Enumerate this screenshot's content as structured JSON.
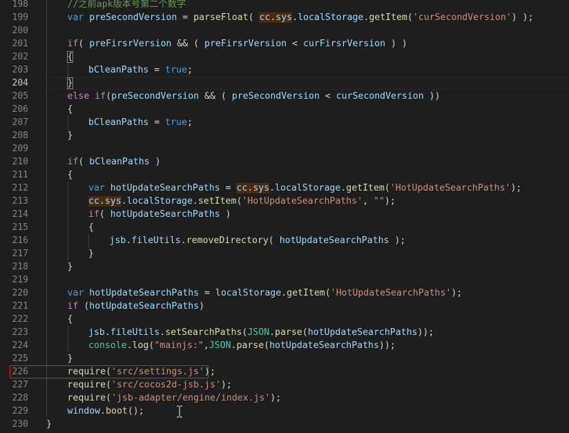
{
  "colors": {
    "background": "#1e1e1e",
    "keyword": "#569cd6",
    "control": "#c586c0",
    "function": "#dcdcaa",
    "string": "#ce9178",
    "comment": "#6a9955",
    "variable": "#9cdcfe",
    "type": "#4ec9b0",
    "highlight_box": "#e01e1e"
  },
  "lines": [
    {
      "n": "198",
      "indent": 1,
      "tokens": [
        [
          "cm",
          "//之前apk版本号第二个数字"
        ]
      ]
    },
    {
      "n": "199",
      "indent": 1,
      "tokens": [
        [
          "kw",
          "var"
        ],
        [
          "pl",
          " "
        ],
        [
          "var",
          "preSecondVersion"
        ],
        [
          "pl",
          " = "
        ],
        [
          "fn",
          "parseFloat"
        ],
        [
          "pl",
          "( "
        ],
        [
          "var hl",
          "cc"
        ],
        [
          "pl hl",
          "."
        ],
        [
          "var hl",
          "sys"
        ],
        [
          "pl",
          "."
        ],
        [
          "var",
          "localStorage"
        ],
        [
          "pl",
          "."
        ],
        [
          "fn",
          "getItem"
        ],
        [
          "pl",
          "("
        ],
        [
          "str",
          "'curSecondVersion'"
        ],
        [
          "pl",
          ") );"
        ]
      ]
    },
    {
      "n": "200",
      "indent": 1,
      "tokens": []
    },
    {
      "n": "201",
      "indent": 1,
      "tokens": [
        [
          "kwc",
          "if"
        ],
        [
          "pl",
          "( "
        ],
        [
          "var",
          "preFirsrVersion"
        ],
        [
          "pl",
          " && ( "
        ],
        [
          "var",
          "preFirsrVersion"
        ],
        [
          "pl",
          " < "
        ],
        [
          "var",
          "curFirsrVersion"
        ],
        [
          "pl",
          " ) )"
        ]
      ]
    },
    {
      "n": "202",
      "indent": 1,
      "tokens": [
        [
          "pl br",
          "{"
        ]
      ]
    },
    {
      "n": "203",
      "indent": 2,
      "tokens": [
        [
          "var",
          "bCleanPaths"
        ],
        [
          "pl",
          " = "
        ],
        [
          "kw",
          "true"
        ],
        [
          "pl",
          ";"
        ]
      ]
    },
    {
      "n": "204",
      "indent": 1,
      "active": true,
      "tokens": [
        [
          "pl br",
          "}"
        ]
      ]
    },
    {
      "n": "205",
      "indent": 1,
      "tokens": [
        [
          "kwc",
          "else"
        ],
        [
          "pl",
          " "
        ],
        [
          "kwc",
          "if"
        ],
        [
          "pl",
          "("
        ],
        [
          "var",
          "preSecondVersion"
        ],
        [
          "pl",
          " && ( "
        ],
        [
          "var",
          "preSecondVersion"
        ],
        [
          "pl",
          " < "
        ],
        [
          "var",
          "curSecondVersion"
        ],
        [
          "pl",
          " ))"
        ]
      ]
    },
    {
      "n": "206",
      "indent": 1,
      "tokens": [
        [
          "pl",
          "{"
        ]
      ]
    },
    {
      "n": "207",
      "indent": 2,
      "tokens": [
        [
          "var",
          "bCleanPaths"
        ],
        [
          "pl",
          " = "
        ],
        [
          "kw",
          "true"
        ],
        [
          "pl",
          ";"
        ]
      ]
    },
    {
      "n": "208",
      "indent": 1,
      "tokens": [
        [
          "pl",
          "}"
        ]
      ]
    },
    {
      "n": "209",
      "indent": 1,
      "tokens": []
    },
    {
      "n": "210",
      "indent": 1,
      "tokens": [
        [
          "kwc",
          "if"
        ],
        [
          "pl",
          "( "
        ],
        [
          "var",
          "bCleanPaths"
        ],
        [
          "pl",
          " )"
        ]
      ]
    },
    {
      "n": "211",
      "indent": 1,
      "tokens": [
        [
          "pl",
          "{"
        ]
      ]
    },
    {
      "n": "212",
      "indent": 2,
      "tokens": [
        [
          "kw",
          "var"
        ],
        [
          "pl",
          " "
        ],
        [
          "var",
          "hotUpdateSearchPaths"
        ],
        [
          "pl",
          " = "
        ],
        [
          "var hl",
          "cc"
        ],
        [
          "pl hl",
          "."
        ],
        [
          "var hl",
          "sys"
        ],
        [
          "pl",
          "."
        ],
        [
          "var",
          "localStorage"
        ],
        [
          "pl",
          "."
        ],
        [
          "fn",
          "getItem"
        ],
        [
          "pl",
          "("
        ],
        [
          "str",
          "'HotUpdateSearchPaths'"
        ],
        [
          "pl",
          ");"
        ]
      ]
    },
    {
      "n": "213",
      "indent": 2,
      "tokens": [
        [
          "var hl",
          "cc"
        ],
        [
          "pl hl",
          "."
        ],
        [
          "var hl",
          "sys"
        ],
        [
          "pl",
          "."
        ],
        [
          "var",
          "localStorage"
        ],
        [
          "pl",
          "."
        ],
        [
          "fn",
          "setItem"
        ],
        [
          "pl",
          "("
        ],
        [
          "str",
          "'HotUpdateSearchPaths'"
        ],
        [
          "pl",
          ", "
        ],
        [
          "str",
          "\"\""
        ],
        [
          "pl",
          ");"
        ]
      ]
    },
    {
      "n": "214",
      "indent": 2,
      "tokens": [
        [
          "kwc",
          "if"
        ],
        [
          "pl",
          "( "
        ],
        [
          "var",
          "hotUpdateSearchPaths"
        ],
        [
          "pl",
          " )"
        ]
      ]
    },
    {
      "n": "215",
      "indent": 2,
      "tokens": [
        [
          "pl",
          "{"
        ]
      ]
    },
    {
      "n": "216",
      "indent": 3,
      "tokens": [
        [
          "var",
          "jsb"
        ],
        [
          "pl",
          "."
        ],
        [
          "var",
          "fileUtils"
        ],
        [
          "pl",
          "."
        ],
        [
          "fn",
          "removeDirectory"
        ],
        [
          "pl",
          "( "
        ],
        [
          "var",
          "hotUpdateSearchPaths"
        ],
        [
          "pl",
          " );"
        ]
      ]
    },
    {
      "n": "217",
      "indent": 2,
      "tokens": [
        [
          "pl",
          "}"
        ]
      ]
    },
    {
      "n": "218",
      "indent": 1,
      "tokens": [
        [
          "pl",
          "}"
        ]
      ]
    },
    {
      "n": "219",
      "indent": 1,
      "tokens": []
    },
    {
      "n": "220",
      "indent": 1,
      "tokens": [
        [
          "kw",
          "var"
        ],
        [
          "pl",
          " "
        ],
        [
          "var",
          "hotUpdateSearchPaths"
        ],
        [
          "pl",
          " = "
        ],
        [
          "var",
          "localStorage"
        ],
        [
          "pl",
          "."
        ],
        [
          "fn",
          "getItem"
        ],
        [
          "pl",
          "("
        ],
        [
          "str",
          "'HotUpdateSearchPaths'"
        ],
        [
          "pl",
          ");"
        ]
      ]
    },
    {
      "n": "221",
      "indent": 1,
      "tokens": [
        [
          "kwc",
          "if"
        ],
        [
          "pl",
          " ("
        ],
        [
          "var",
          "hotUpdateSearchPaths"
        ],
        [
          "pl",
          ")"
        ]
      ]
    },
    {
      "n": "222",
      "indent": 1,
      "tokens": [
        [
          "pl",
          "{"
        ]
      ]
    },
    {
      "n": "223",
      "indent": 2,
      "tokens": [
        [
          "var",
          "jsb"
        ],
        [
          "pl",
          "."
        ],
        [
          "var",
          "fileUtils"
        ],
        [
          "pl",
          "."
        ],
        [
          "fn",
          "setSearchPaths"
        ],
        [
          "pl",
          "("
        ],
        [
          "cls",
          "JSON"
        ],
        [
          "pl",
          "."
        ],
        [
          "fn",
          "parse"
        ],
        [
          "pl",
          "("
        ],
        [
          "var",
          "hotUpdateSearchPaths"
        ],
        [
          "pl",
          "));"
        ]
      ]
    },
    {
      "n": "224",
      "indent": 2,
      "tokens": [
        [
          "cls",
          "console"
        ],
        [
          "pl",
          "."
        ],
        [
          "fn",
          "log"
        ],
        [
          "pl",
          "("
        ],
        [
          "str",
          "\"mainjs:\""
        ],
        [
          "pl",
          ","
        ],
        [
          "cls",
          "JSON"
        ],
        [
          "pl",
          "."
        ],
        [
          "fn",
          "parse"
        ],
        [
          "pl",
          "("
        ],
        [
          "var",
          "hotUpdateSearchPaths"
        ],
        [
          "pl",
          "));"
        ]
      ]
    },
    {
      "n": "225",
      "indent": 1,
      "tokens": [
        [
          "pl",
          "}"
        ]
      ]
    },
    {
      "n": "226",
      "indent": 1,
      "tokens": [
        [
          "fn",
          "require"
        ],
        [
          "pl",
          "("
        ],
        [
          "str",
          "'src/settings.js'"
        ],
        [
          "pl",
          ");"
        ]
      ]
    },
    {
      "n": "227",
      "indent": 1,
      "tokens": [
        [
          "fn",
          "require"
        ],
        [
          "pl",
          "("
        ],
        [
          "str",
          "'src/cocos2d-jsb.js'"
        ],
        [
          "pl",
          ");"
        ]
      ]
    },
    {
      "n": "228",
      "indent": 1,
      "tokens": [
        [
          "fn",
          "require"
        ],
        [
          "pl",
          "("
        ],
        [
          "str",
          "'jsb-adapter/engine/index.js'"
        ],
        [
          "pl",
          ");"
        ]
      ]
    },
    {
      "n": "229",
      "indent": 1,
      "tokens": [
        [
          "var",
          "window"
        ],
        [
          "pl",
          "."
        ],
        [
          "fn",
          "boot"
        ],
        [
          "pl",
          "();"
        ]
      ]
    },
    {
      "n": "230",
      "indent": 0,
      "tokens": [
        [
          "pl",
          "}"
        ]
      ]
    }
  ]
}
